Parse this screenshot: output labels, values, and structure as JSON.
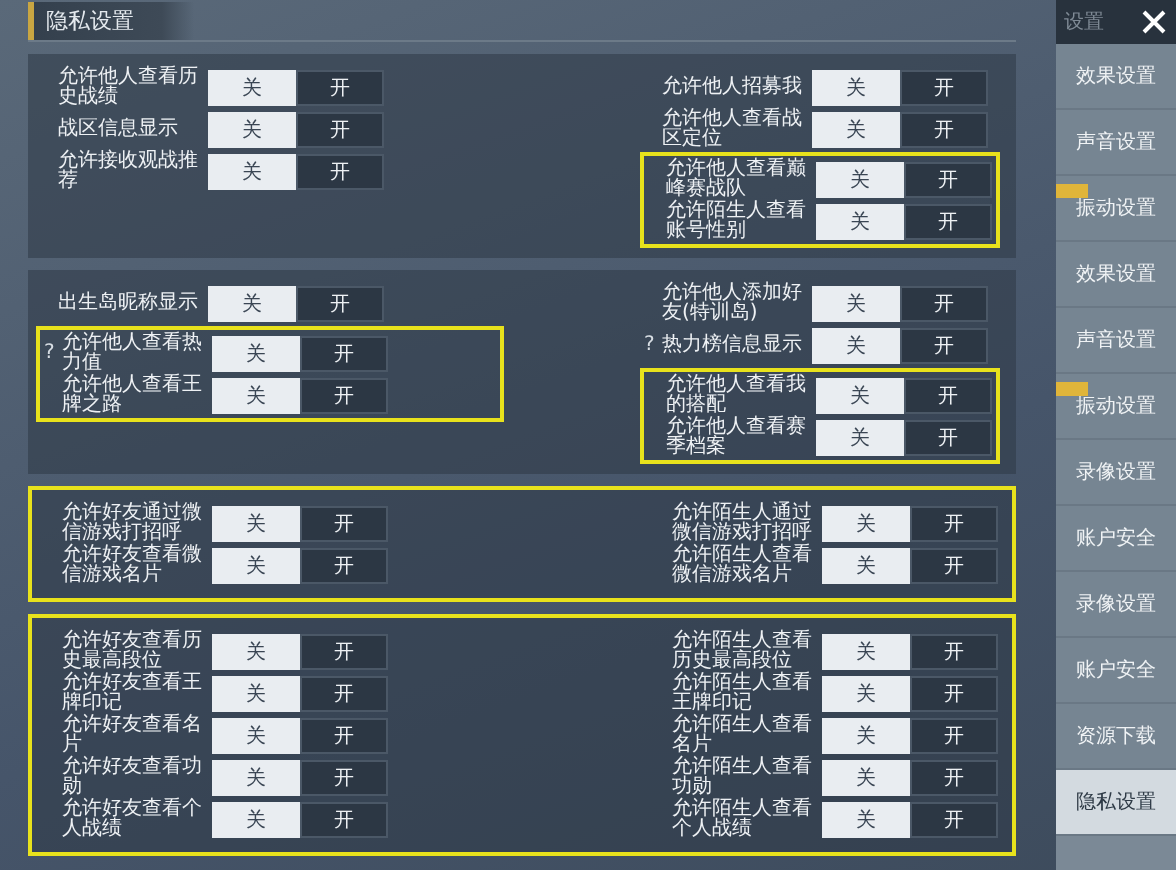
{
  "title": "隐私设置",
  "panels": [
    {
      "highlighted": false,
      "left": [
        {
          "highlighted": false,
          "rows": [
            {
              "label": "允许他人查看历史战绩",
              "options": [
                {
                  "label": "关",
                  "selected": true
                },
                {
                  "label": "开",
                  "selected": false
                }
              ]
            },
            {
              "label": "战区信息显示",
              "options": [
                {
                  "label": "关",
                  "selected": true
                },
                {
                  "label": "开",
                  "selected": false
                }
              ]
            },
            {
              "label": "允许接收观战推荐",
              "options": [
                {
                  "label": "关",
                  "selected": true
                },
                {
                  "label": "开",
                  "selected": false
                }
              ]
            }
          ]
        }
      ],
      "right": [
        {
          "highlighted": false,
          "rows": [
            {
              "label": "允许他人招募我",
              "options": [
                {
                  "label": "关",
                  "selected": true
                },
                {
                  "label": "开",
                  "selected": false
                }
              ]
            },
            {
              "label": "允许他人查看战区定位",
              "options": [
                {
                  "label": "关",
                  "selected": true
                },
                {
                  "label": "开",
                  "selected": false
                }
              ]
            }
          ]
        },
        {
          "highlighted": true,
          "rows": [
            {
              "label": "允许他人查看巅峰赛战队",
              "options": [
                {
                  "label": "关",
                  "selected": true
                },
                {
                  "label": "开",
                  "selected": false
                }
              ]
            },
            {
              "label": "允许陌生人查看账号性别",
              "options": [
                {
                  "label": "关",
                  "selected": true
                },
                {
                  "label": "开",
                  "selected": false
                }
              ]
            }
          ]
        }
      ]
    },
    {
      "highlighted": false,
      "left": [
        {
          "highlighted": false,
          "rows": [
            {
              "label": "出生岛昵称显示",
              "options": [
                {
                  "label": "关",
                  "selected": true
                },
                {
                  "label": "开",
                  "selected": false
                }
              ]
            }
          ]
        },
        {
          "highlighted": true,
          "rows": [
            {
              "label": "允许他人查看热力值",
              "hint": "?",
              "options": [
                {
                  "label": "关",
                  "selected": true
                },
                {
                  "label": "开",
                  "selected": false
                }
              ]
            },
            {
              "label": "允许他人查看王牌之路",
              "options": [
                {
                  "label": "关",
                  "selected": true
                },
                {
                  "label": "开",
                  "selected": false
                }
              ]
            }
          ]
        }
      ],
      "right": [
        {
          "highlighted": false,
          "rows": [
            {
              "label": "允许他人添加好友(特训岛)",
              "options": [
                {
                  "label": "关",
                  "selected": true
                },
                {
                  "label": "开",
                  "selected": false
                }
              ]
            },
            {
              "label": "热力榜信息显示",
              "hint": "?",
              "options": [
                {
                  "label": "关",
                  "selected": true
                },
                {
                  "label": "开",
                  "selected": false
                }
              ]
            }
          ]
        },
        {
          "highlighted": true,
          "rows": [
            {
              "label": "允许他人查看我的搭配",
              "options": [
                {
                  "label": "关",
                  "selected": true
                },
                {
                  "label": "开",
                  "selected": false
                }
              ]
            },
            {
              "label": "允许他人查看赛季档案",
              "options": [
                {
                  "label": "关",
                  "selected": true
                },
                {
                  "label": "开",
                  "selected": false
                }
              ]
            }
          ]
        }
      ]
    },
    {
      "highlighted": true,
      "left": [
        {
          "highlighted": false,
          "rows": [
            {
              "label": "允许好友通过微信游戏打招呼",
              "options": [
                {
                  "label": "关",
                  "selected": true
                },
                {
                  "label": "开",
                  "selected": false
                }
              ]
            },
            {
              "label": "允许好友查看微信游戏名片",
              "options": [
                {
                  "label": "关",
                  "selected": true
                },
                {
                  "label": "开",
                  "selected": false
                }
              ]
            }
          ]
        }
      ],
      "right": [
        {
          "highlighted": false,
          "rows": [
            {
              "label": "允许陌生人通过微信游戏打招呼",
              "options": [
                {
                  "label": "关",
                  "selected": true
                },
                {
                  "label": "开",
                  "selected": false
                }
              ]
            },
            {
              "label": "允许陌生人查看微信游戏名片",
              "options": [
                {
                  "label": "关",
                  "selected": true
                },
                {
                  "label": "开",
                  "selected": false
                }
              ]
            }
          ]
        }
      ]
    },
    {
      "highlighted": true,
      "left": [
        {
          "highlighted": false,
          "rows": [
            {
              "label": "允许好友查看历史最高段位",
              "options": [
                {
                  "label": "关",
                  "selected": true
                },
                {
                  "label": "开",
                  "selected": false
                }
              ]
            },
            {
              "label": "允许好友查看王牌印记",
              "options": [
                {
                  "label": "关",
                  "selected": true
                },
                {
                  "label": "开",
                  "selected": false
                }
              ]
            },
            {
              "label": "允许好友查看名片",
              "options": [
                {
                  "label": "关",
                  "selected": true
                },
                {
                  "label": "开",
                  "selected": false
                }
              ]
            },
            {
              "label": "允许好友查看功勋",
              "options": [
                {
                  "label": "关",
                  "selected": true
                },
                {
                  "label": "开",
                  "selected": false
                }
              ]
            },
            {
              "label": "允许好友查看个人战绩",
              "options": [
                {
                  "label": "关",
                  "selected": true
                },
                {
                  "label": "开",
                  "selected": false
                }
              ]
            }
          ]
        }
      ],
      "right": [
        {
          "highlighted": false,
          "rows": [
            {
              "label": "允许陌生人查看历史最高段位",
              "options": [
                {
                  "label": "关",
                  "selected": true
                },
                {
                  "label": "开",
                  "selected": false
                }
              ]
            },
            {
              "label": "允许陌生人查看王牌印记",
              "options": [
                {
                  "label": "关",
                  "selected": true
                },
                {
                  "label": "开",
                  "selected": false
                }
              ]
            },
            {
              "label": "允许陌生人查看名片",
              "options": [
                {
                  "label": "关",
                  "selected": true
                },
                {
                  "label": "开",
                  "selected": false
                }
              ]
            },
            {
              "label": "允许陌生人查看功勋",
              "options": [
                {
                  "label": "关",
                  "selected": true
                },
                {
                  "label": "开",
                  "selected": false
                }
              ]
            },
            {
              "label": "允许陌生人查看个人战绩",
              "options": [
                {
                  "label": "关",
                  "selected": true
                },
                {
                  "label": "开",
                  "selected": false
                }
              ]
            }
          ]
        }
      ]
    }
  ],
  "sidebar": {
    "header": "设置",
    "items": [
      {
        "label": "效果设置",
        "selected": false,
        "badge": false
      },
      {
        "label": "声音设置",
        "selected": false,
        "badge": false
      },
      {
        "label": "振动设置",
        "selected": false,
        "badge": true
      },
      {
        "label": "效果设置",
        "selected": false,
        "badge": false
      },
      {
        "label": "声音设置",
        "selected": false,
        "badge": false
      },
      {
        "label": "振动设置",
        "selected": false,
        "badge": true
      },
      {
        "label": "录像设置",
        "selected": false,
        "badge": false
      },
      {
        "label": "账户安全",
        "selected": false,
        "badge": false
      },
      {
        "label": "录像设置",
        "selected": false,
        "badge": false
      },
      {
        "label": "账户安全",
        "selected": false,
        "badge": false
      },
      {
        "label": "资源下载",
        "selected": false,
        "badge": false
      },
      {
        "label": "隐私设置",
        "selected": true,
        "badge": false
      }
    ]
  }
}
